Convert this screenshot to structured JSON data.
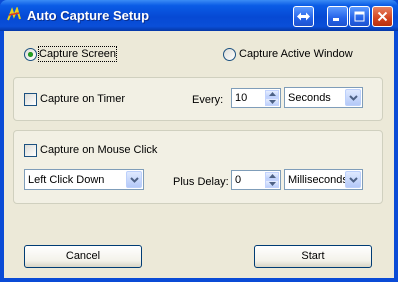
{
  "window": {
    "title": "Auto Capture Setup",
    "icons": {
      "app": "app-icon",
      "restore": "restore-arrows-icon",
      "minimize": "minimize-icon",
      "maximize": "maximize-icon",
      "close": "close-icon"
    }
  },
  "capture_mode": {
    "options": [
      "Capture Screen",
      "Capture Active Window"
    ],
    "selected": "Capture Screen"
  },
  "timer": {
    "checkbox_label": "Capture on Timer",
    "checked": false,
    "every_label": "Every:",
    "every_value": "10",
    "unit": "Seconds"
  },
  "mouse": {
    "checkbox_label": "Capture on Mouse Click",
    "checked": false,
    "click_type": "Left Click Down",
    "delay_label": "Plus Delay:",
    "delay_value": "0",
    "delay_unit": "Milliseconds"
  },
  "buttons": {
    "cancel": "Cancel",
    "start": "Start"
  },
  "colors": {
    "titlebar": "#0a4bd6",
    "dialog_bg": "#ece9d8",
    "radio_selected": "#21a121",
    "close_button": "#d2431e"
  }
}
